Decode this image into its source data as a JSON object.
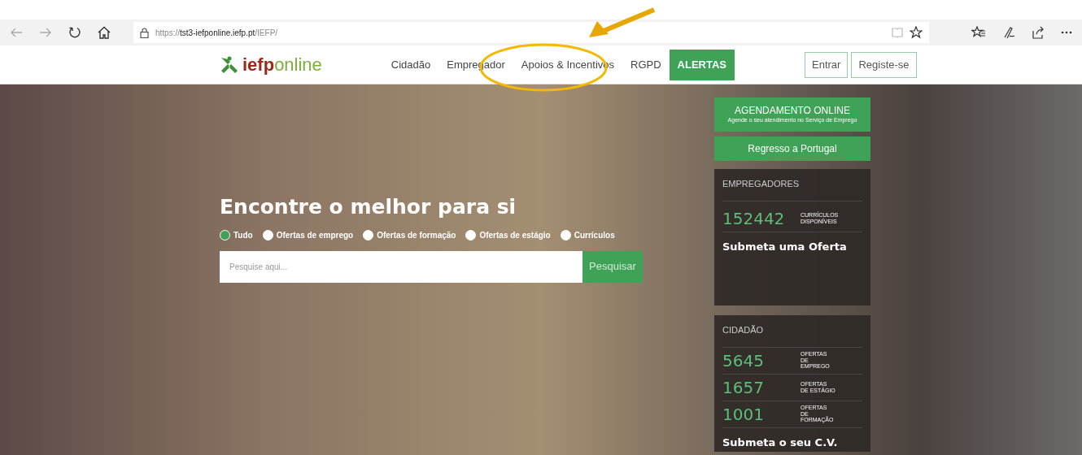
{
  "browser": {
    "url": {
      "scheme": "https://",
      "host": "tst3-iefponline.iefp.pt",
      "path": "/IEFP/"
    }
  },
  "logo": {
    "strong": "iefp",
    "light": "online"
  },
  "nav": [
    {
      "label": "Cidadão",
      "kind": "link"
    },
    {
      "label": "Empregador",
      "kind": "link"
    },
    {
      "label": "Apoios & Incentivos",
      "kind": "link"
    },
    {
      "label": "RGPD",
      "kind": "link"
    },
    {
      "label": "ALERTAS",
      "kind": "highlight"
    }
  ],
  "account": [
    "Entrar",
    "Registe-se"
  ],
  "hero": {
    "title": "Encontre o melhor para si",
    "filters": [
      {
        "label": "Tudo",
        "selected": true
      },
      {
        "label": "Ofertas de emprego",
        "selected": false
      },
      {
        "label": "Ofertas de formação",
        "selected": false
      },
      {
        "label": "Ofertas de estágio",
        "selected": false
      },
      {
        "label": "Currículos",
        "selected": false
      }
    ],
    "search": {
      "placeholder": "Pesquise aqui...",
      "button": "Pesquisar"
    }
  },
  "side_buttons": [
    {
      "title": "AGENDAMENTO ONLINE",
      "subtitle": "Agende o seu atendimento no Serviço de Emprego"
    },
    {
      "title": "Regresso a Portugal"
    }
  ],
  "cards": [
    {
      "title": "EMPREGADORES",
      "stats": [
        {
          "value": "152442",
          "label": "CURRÍCULOS DISPONÍVEIS"
        }
      ],
      "action": "Submeta uma Oferta"
    },
    {
      "title": "CIDADÃO",
      "stats": [
        {
          "value": "5645",
          "label": "OFERTAS DE EMPREGO"
        },
        {
          "value": "1657",
          "label": "OFERTAS DE ESTÁGIO"
        },
        {
          "value": "1001",
          "label": "OFERTAS DE FORMAÇÃO"
        }
      ],
      "action": "Submeta o seu C.V."
    }
  ]
}
